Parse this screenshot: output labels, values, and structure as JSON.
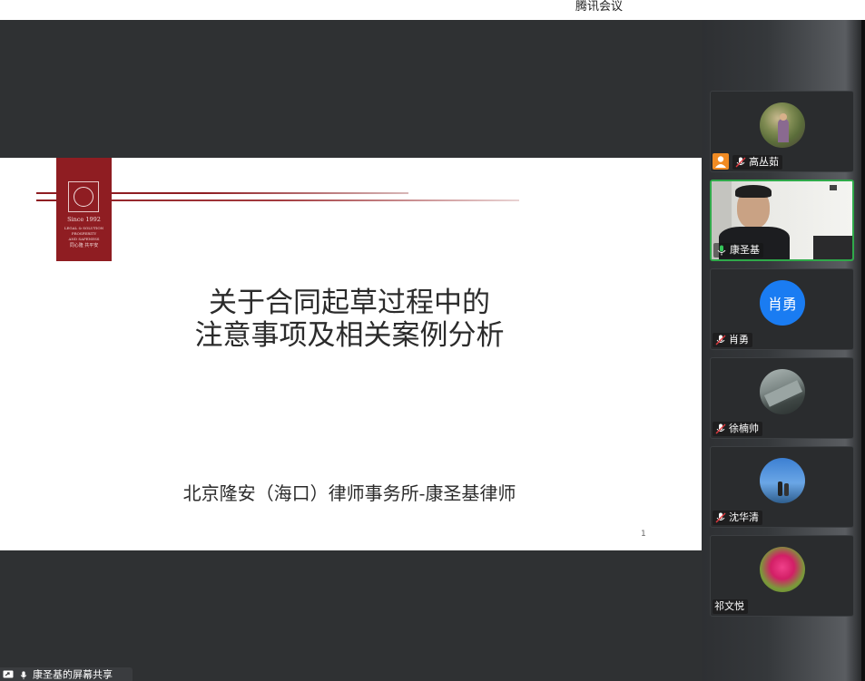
{
  "window": {
    "title": "腾讯会议"
  },
  "slide": {
    "logo": {
      "since": "Since  1992",
      "tagline_1": "LEGAL & SOLUTION",
      "tagline_2": "PROSPERITY",
      "tagline_3": "AND SAFENESS",
      "motto": "同心隆  共平安"
    },
    "title_line_1": "关于合同起草过程中的",
    "title_line_2": "注意事项及相关案例分析",
    "subtitle": "北京隆安（海口）律师事务所-康圣基律师",
    "page_number": "1"
  },
  "share_tag": {
    "label": "康圣基的屏幕共享",
    "icon": "screen-share-icon",
    "mic_icon": "mic-icon"
  },
  "participants": [
    {
      "name": "高丛茹",
      "avatar": "photo-avatar",
      "mic": "mic-muted-icon",
      "host": true,
      "video": false
    },
    {
      "name": "康圣基",
      "avatar": "video-feed",
      "mic": "mic-active-icon",
      "host": false,
      "video": true
    },
    {
      "name": "肖勇",
      "avatar_text": "肖勇",
      "avatar_color": "#1a7cf2",
      "mic": "mic-muted-icon",
      "host": false,
      "video": false
    },
    {
      "name": "徐楠帅",
      "avatar": "photo-avatar",
      "mic": "mic-muted-icon",
      "host": false,
      "video": false
    },
    {
      "name": "沈华清",
      "avatar": "photo-avatar",
      "mic": "mic-muted-icon",
      "host": false,
      "video": false
    },
    {
      "name": "祁文悦",
      "avatar": "photo-avatar",
      "host": false,
      "video": false
    }
  ],
  "colors": {
    "stage_bg": "#2f3133",
    "brand_red": "#8f1d22",
    "active_speaker": "#2fa94a",
    "avatar_blue": "#1a7cf2",
    "host_orange": "#f08b23",
    "mic_muted_red": "#e0393e"
  }
}
